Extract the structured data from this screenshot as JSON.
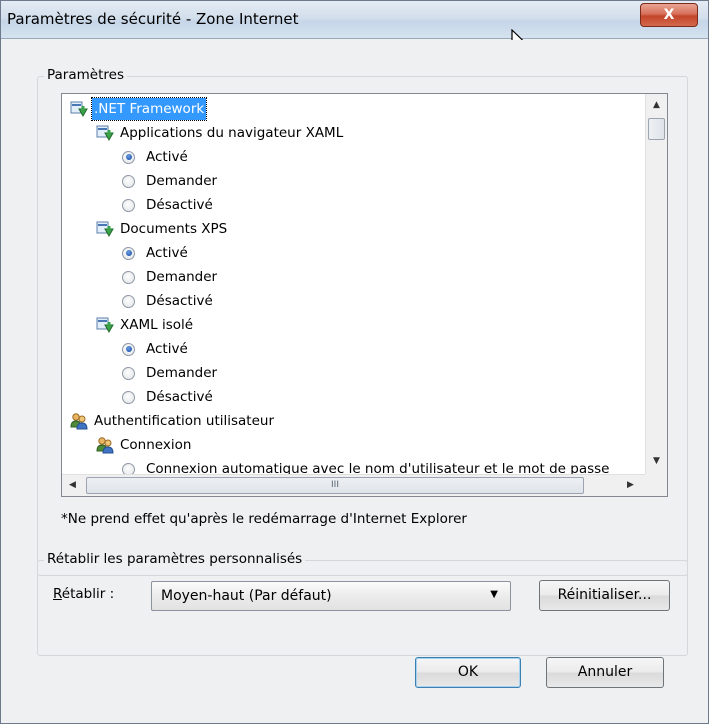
{
  "window": {
    "title": "Paramètres de sécurité - Zone Internet",
    "close_glyph": "X"
  },
  "settings_group": {
    "label": "Paramètres",
    "tree": [
      {
        "kind": "category",
        "label": ".NET Framework",
        "icon": "settings-category-icon",
        "selected": true
      },
      {
        "kind": "category",
        "label": "Applications du navigateur XAML",
        "icon": "settings-category-icon"
      },
      {
        "kind": "radio",
        "label": "Activé",
        "checked": true
      },
      {
        "kind": "radio",
        "label": "Demander",
        "checked": false
      },
      {
        "kind": "radio",
        "label": "Désactivé",
        "checked": false
      },
      {
        "kind": "category",
        "label": "Documents XPS",
        "icon": "settings-category-icon"
      },
      {
        "kind": "radio",
        "label": "Activé",
        "checked": true
      },
      {
        "kind": "radio",
        "label": "Demander",
        "checked": false
      },
      {
        "kind": "radio",
        "label": "Désactivé",
        "checked": false
      },
      {
        "kind": "category",
        "label": "XAML isolé",
        "icon": "settings-category-icon"
      },
      {
        "kind": "radio",
        "label": "Activé",
        "checked": true
      },
      {
        "kind": "radio",
        "label": "Demander",
        "checked": false
      },
      {
        "kind": "radio",
        "label": "Désactivé",
        "checked": false
      },
      {
        "kind": "category",
        "label": "Authentification utilisateur",
        "icon": "users-icon"
      },
      {
        "kind": "category",
        "label": "Connexion",
        "icon": "users-icon"
      },
      {
        "kind": "radio",
        "label": "Connexion automatique avec le nom d'utilisateur et le mot de passe",
        "checked": false
      }
    ],
    "hscroll_grip": "III",
    "note": "*Ne prend effet qu'après le redémarrage d'Internet Explorer"
  },
  "reset_group": {
    "label": "Rétablir les paramètres personnalisés",
    "reset_label": "Rétablir :",
    "selected_level": "Moyen-haut (Par défaut)",
    "reset_button": "Réinitialiser..."
  },
  "footer": {
    "ok": "OK",
    "cancel": "Annuler"
  }
}
